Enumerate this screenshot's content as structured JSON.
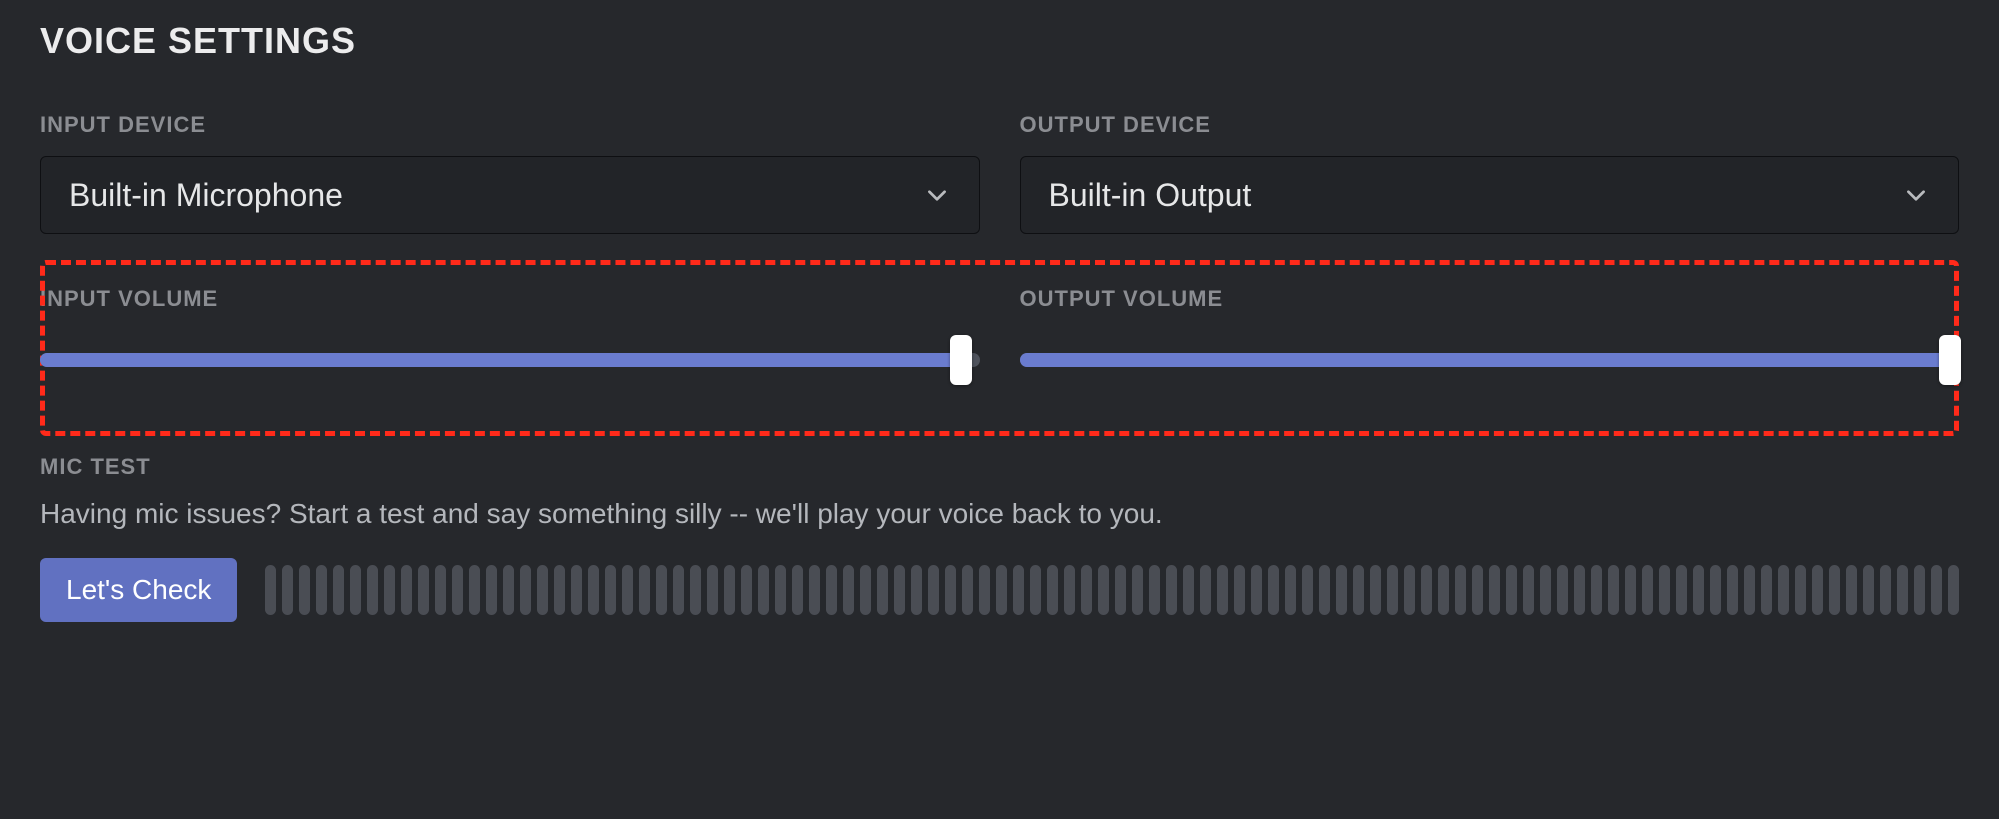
{
  "section_title": "VOICE SETTINGS",
  "input_device": {
    "label": "INPUT DEVICE",
    "value": "Built-in Microphone"
  },
  "output_device": {
    "label": "OUTPUT DEVICE",
    "value": "Built-in Output"
  },
  "input_volume": {
    "label": "INPUT VOLUME",
    "percent": 98
  },
  "output_volume": {
    "label": "OUTPUT VOLUME",
    "percent": 99
  },
  "mic_test": {
    "label": "MIC TEST",
    "help": "Having mic issues? Start a test and say something silly -- we'll play your voice back to you.",
    "button": "Let's Check"
  },
  "colors": {
    "accent": "#6a7ccf",
    "button": "#6171c1",
    "highlight_border": "#ff2a1a"
  }
}
